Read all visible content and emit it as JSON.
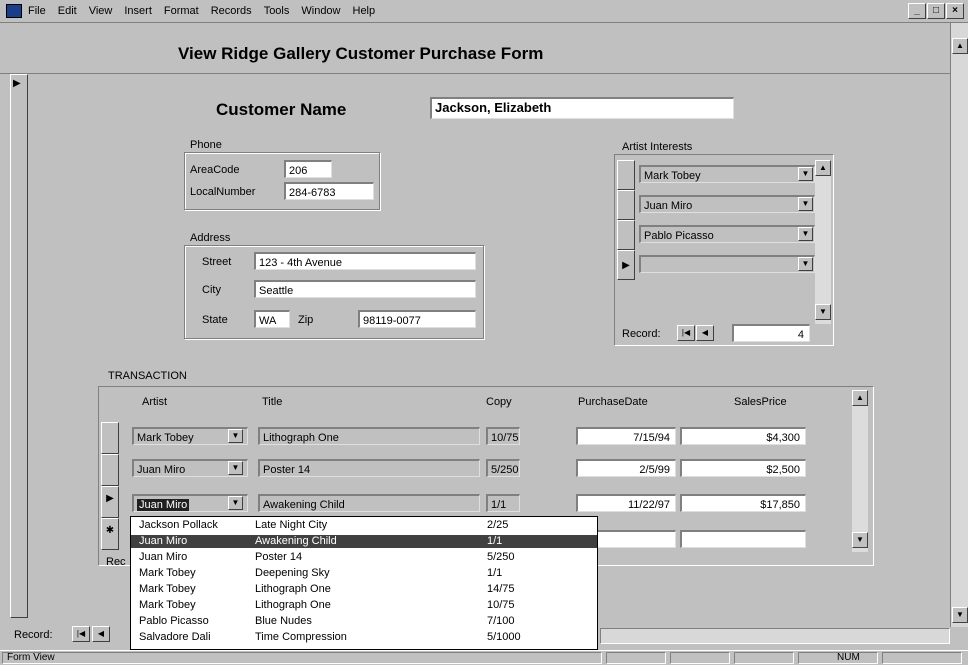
{
  "menu": [
    "File",
    "Edit",
    "View",
    "Insert",
    "Format",
    "Records",
    "Tools",
    "Window",
    "Help"
  ],
  "window_buttons": [
    "_",
    "□",
    "×"
  ],
  "form": {
    "title": "View Ridge Gallery Customer Purchase Form",
    "customer_name_label": "Customer Name",
    "customer_name": "Jackson, Elizabeth",
    "phone": {
      "group_label": "Phone",
      "area_code_label": "AreaCode",
      "area_code": "206",
      "local_number_label": "LocalNumber",
      "local_number": "284-6783"
    },
    "address": {
      "group_label": "Address",
      "street_label": "Street",
      "street": "123 - 4th Avenue",
      "city_label": "City",
      "city": "Seattle",
      "state_label": "State",
      "state": "WA",
      "zip_label": "Zip",
      "zip": "98119-0077"
    },
    "artist_interests": {
      "label": "Artist Interests",
      "items": [
        "Mark Tobey",
        "Juan Miro",
        "Pablo Picasso",
        ""
      ],
      "record_label": "Record:",
      "record_value": "4"
    },
    "transaction": {
      "label": "TRANSACTION",
      "columns": [
        "Artist",
        "Title",
        "Copy",
        "PurchaseDate",
        "SalesPrice"
      ],
      "rows": [
        {
          "artist": "Mark Tobey",
          "title": "Lithograph One",
          "copy": "10/75",
          "date": "7/15/94",
          "price": "$4,300"
        },
        {
          "artist": "Juan Miro",
          "title": "Poster 14",
          "copy": "5/250",
          "date": "2/5/99",
          "price": "$2,500"
        },
        {
          "artist": "Juan Miro",
          "title": "Awakening Child",
          "copy": "1/1",
          "date": "11/22/97",
          "price": "$17,850"
        }
      ],
      "record_label_partial": "Rec"
    },
    "dropdown": [
      {
        "artist": "Jackson Pollack",
        "title": "Late Night City",
        "copy": "2/25"
      },
      {
        "artist": "Juan Miro",
        "title": "Awakening Child",
        "copy": "1/1"
      },
      {
        "artist": "Juan Miro",
        "title": "Poster 14",
        "copy": "5/250"
      },
      {
        "artist": "Mark Tobey",
        "title": "Deepening Sky",
        "copy": "1/1"
      },
      {
        "artist": "Mark Tobey",
        "title": "Lithograph One",
        "copy": "14/75"
      },
      {
        "artist": "Mark Tobey",
        "title": "Lithograph One",
        "copy": "10/75"
      },
      {
        "artist": "Pablo Picasso",
        "title": "Blue Nudes",
        "copy": "7/100"
      },
      {
        "artist": "Salvadore Dali",
        "title": "Time Compression",
        "copy": "5/1000"
      }
    ],
    "bottom_record_label": "Record:"
  },
  "status": {
    "view": "Form View",
    "num": "NUM"
  }
}
